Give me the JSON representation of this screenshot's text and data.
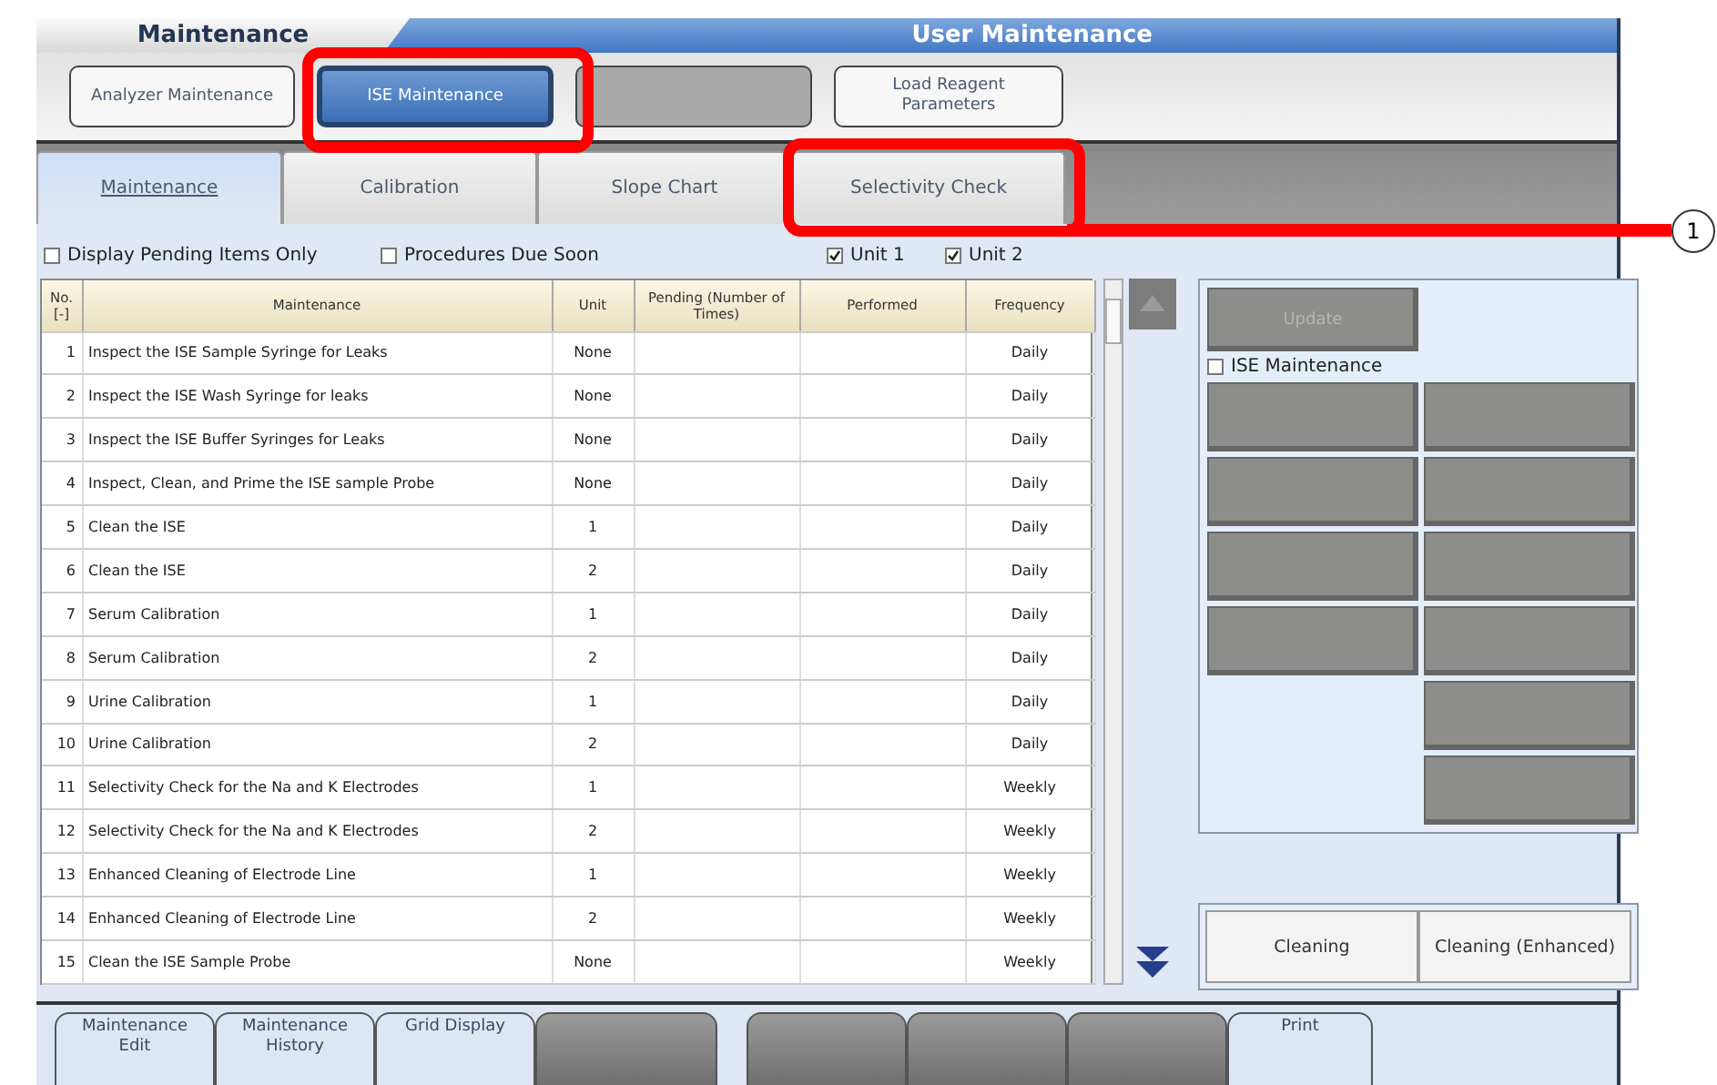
{
  "header": {
    "section": "Maintenance",
    "title": "User Maintenance"
  },
  "mode_buttons": [
    {
      "label": "Analyzer Maintenance",
      "selected": false,
      "disabled": false
    },
    {
      "label": "ISE Maintenance",
      "selected": true,
      "disabled": false
    },
    {
      "selected": false,
      "disabled": true
    },
    {
      "label": "Load Reagent Parameters",
      "selected": false,
      "disabled": false
    }
  ],
  "tabs": [
    {
      "label": "Maintenance",
      "selected": true
    },
    {
      "label": "Calibration",
      "selected": false
    },
    {
      "label": "Slope Chart",
      "selected": false
    },
    {
      "label": "Selectivity Check",
      "selected": false
    }
  ],
  "filters": [
    {
      "label": "Display Pending Items Only",
      "checked": false
    },
    {
      "label": "Procedures Due Soon",
      "checked": false
    },
    {
      "label": "Unit 1",
      "checked": true
    },
    {
      "label": "Unit 2",
      "checked": true
    }
  ],
  "table": {
    "columns": [
      "No. [-]",
      "Maintenance",
      "Unit",
      "Pending (Number of Times)",
      "Performed",
      "Frequency"
    ],
    "rows": [
      [
        "1",
        "Inspect the ISE Sample Syringe for Leaks",
        "None",
        "",
        "",
        "Daily"
      ],
      [
        "2",
        "Inspect the ISE Wash Syringe for leaks",
        "None",
        "",
        "",
        "Daily"
      ],
      [
        "3",
        "Inspect the ISE Buffer Syringes for Leaks",
        "None",
        "",
        "",
        "Daily"
      ],
      [
        "4",
        "Inspect, Clean, and Prime the ISE sample Probe",
        "None",
        "",
        "",
        "Daily"
      ],
      [
        "5",
        "Clean the ISE",
        "1",
        "",
        "",
        "Daily"
      ],
      [
        "6",
        "Clean the ISE",
        "2",
        "",
        "",
        "Daily"
      ],
      [
        "7",
        "Serum Calibration",
        "1",
        "",
        "",
        "Daily"
      ],
      [
        "8",
        "Serum Calibration",
        "2",
        "",
        "",
        "Daily"
      ],
      [
        "9",
        "Urine Calibration",
        "1",
        "",
        "",
        "Daily"
      ],
      [
        "10",
        "Urine Calibration",
        "2",
        "",
        "",
        "Daily"
      ],
      [
        "11",
        "Selectivity Check for the Na and K Electrodes",
        "1",
        "",
        "",
        "Weekly"
      ],
      [
        "12",
        "Selectivity Check for the Na and K Electrodes",
        "2",
        "",
        "",
        "Weekly"
      ],
      [
        "13",
        "Enhanced Cleaning of Electrode Line",
        "1",
        "",
        "",
        "Weekly"
      ],
      [
        "14",
        "Enhanced Cleaning of Electrode Line",
        "2",
        "",
        "",
        "Weekly"
      ],
      [
        "15",
        "Clean the ISE Sample Probe",
        "None",
        "",
        "",
        "Weekly"
      ]
    ]
  },
  "side_panel": {
    "top_button": {
      "label": "Update",
      "disabled": true
    },
    "option": {
      "label": "ISE Maintenance",
      "checked": false
    },
    "button_columns": [
      [
        {
          "disabled": true
        },
        {
          "disabled": true
        },
        {
          "disabled": true
        },
        {
          "disabled": true
        }
      ],
      [
        {
          "disabled": true
        },
        {
          "disabled": true
        },
        {
          "disabled": true
        },
        {
          "disabled": true
        },
        {
          "disabled": true
        },
        {
          "disabled": true
        }
      ]
    ],
    "cleaning_buttons": [
      {
        "label": "Cleaning",
        "disabled": false
      },
      {
        "label": "Cleaning (Enhanced)",
        "disabled": false
      }
    ]
  },
  "footer_buttons": [
    {
      "label": "Maintenance Edit",
      "disabled": false
    },
    {
      "label": "Maintenance History",
      "disabled": false
    },
    {
      "label": "Grid Display",
      "disabled": false
    },
    {
      "disabled": true
    },
    {
      "disabled": true
    },
    {
      "disabled": true
    },
    {
      "disabled": true
    },
    {
      "label": "Print",
      "disabled": false
    }
  ],
  "callout": {
    "label": "1"
  }
}
